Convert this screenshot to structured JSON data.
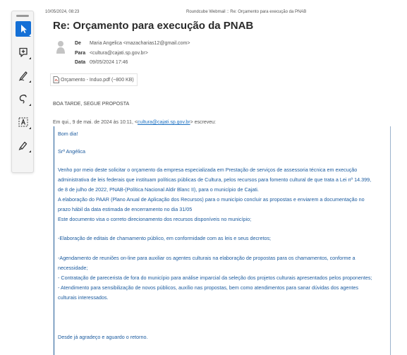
{
  "print_header": {
    "datetime": "10/05/2024, 08:23",
    "title": "Roundcube Webmail :: Re: Orçamento para execução da PNAB"
  },
  "message": {
    "subject": "Re: Orçamento para execução da PNAB",
    "from_label": "De",
    "from_value": "Maria Angelica <mazacharias12@gmail.com>",
    "to_label": "Para",
    "to_value": "<cultura@cajati.sp.gov.br>",
    "date_label": "Data",
    "date_value": "09/05/2024 17:46",
    "attachment": "Orçamento - Induo.pdf (~800 KB)",
    "greeting_reply": "BOA TARDE, SEGUE PROPOSTA",
    "quote_intro_prefix": "Em qui., 9 de mai. de 2024 às 10:11, <",
    "quote_intro_email": "cultura@cajati.sp.gov.br",
    "quote_intro_suffix": "> escreveu:"
  },
  "quoted": {
    "l1": "Bom dia!",
    "l2": "Srª Angélica",
    "l3": "Venho por meio deste solicitar o orçamento da  empresa especializada em Prestação de serviços de assessoria técnica em execução",
    "l4": "administrativa de leis federais que instituam políticas públicas de Cultura, pelos recursos para fomento cultural de que trata a Lei nº 14.399,",
    "l5": "de 8 de julho de 2022, PNAB-(Política Nacional Aldir Blanc II), para o município de Cajati.",
    "l6": "A elaboração do PAAR (Plano Anual de Aplicação dos Recursos) para o município concluir as propostas e enviarem a documentação no",
    "l7": "prazo hábil da data estimada de encerramento no dia 31/05",
    "l8": "Este documento visa o correto direcionamento dos recursos disponíveis no município;",
    "l9": "-Elaboração de editais de chamamento público, em conformidade com as leis e seus decretos;",
    "l10": "-Agendamento de reuniões on-line para auxiliar os agentes culturais na elaboração de propostas para os chamamentos, conforme a",
    "l11": "necessidade;",
    "l12": "- Contratação de parecerista de fora do município para análise imparcial da seleção dos projetos culturais apresentados pelos proponentes;",
    "l13": "- Atendimento para sensibilização de novos públicos, auxílio nas propostas, bem como atendimentos para sanar dúvidas dos agentes",
    "l14": "culturais interessados.",
    "l15": "Desde já agradeço e aguardo o retorno."
  },
  "icons": {
    "select": "cursor-arrow-icon",
    "comment": "add-comment-icon",
    "draw": "pen-icon",
    "lasso": "lasso-icon",
    "text": "text-box-icon",
    "highlight": "highlighter-icon"
  }
}
